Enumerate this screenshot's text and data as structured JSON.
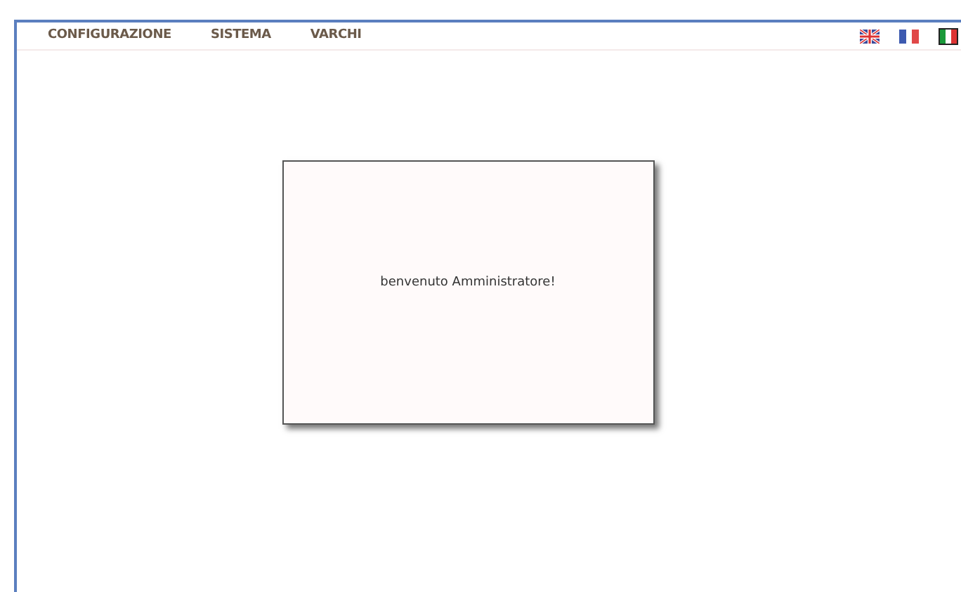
{
  "menu": [
    {
      "label": "CONFIGURAZIONE"
    },
    {
      "label": "SISTEMA"
    },
    {
      "label": "VARCHI"
    }
  ],
  "languages": [
    {
      "kind": "uk"
    },
    {
      "kind": "france"
    },
    {
      "kind": "italy"
    }
  ],
  "dialog": {
    "message": "benvenuto Amministratore!"
  }
}
